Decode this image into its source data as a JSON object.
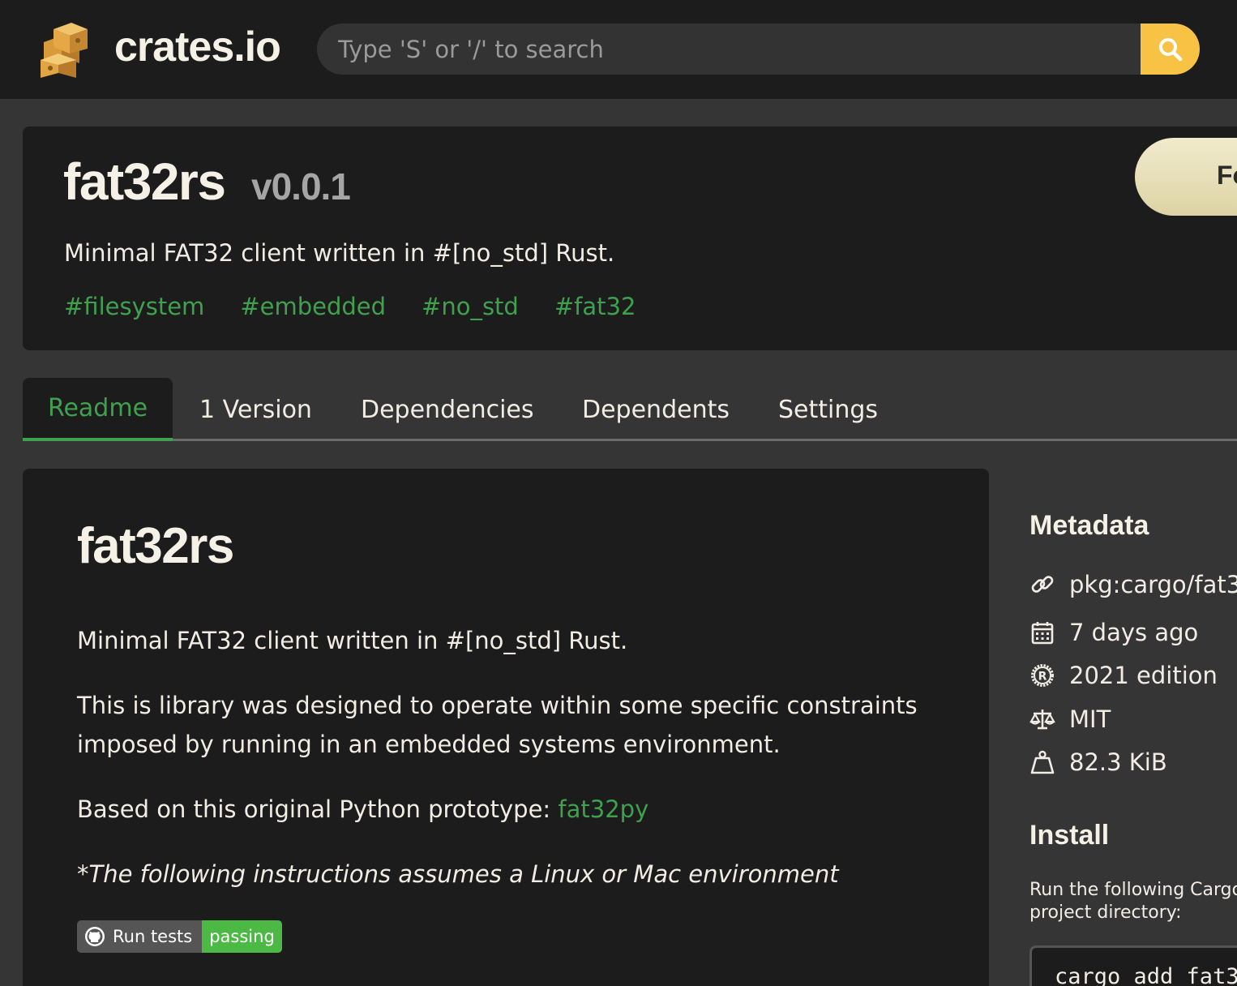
{
  "header": {
    "brand": "crates.io",
    "search_placeholder": "Type 'S' or '/' to search"
  },
  "crate": {
    "name": "fat32rs",
    "version": "v0.0.1",
    "description": "Minimal FAT32 client written in #[no_std] Rust.",
    "keywords": [
      "#filesystem",
      "#embedded",
      "#no_std",
      "#fat32"
    ],
    "follow_label": "Fo"
  },
  "tabs": [
    "Readme",
    "1 Version",
    "Dependencies",
    "Dependents",
    "Settings"
  ],
  "readme": {
    "title": "fat32rs",
    "p1": "Minimal FAT32 client written in #[no_std] Rust.",
    "p2": "This is library was designed to operate within some specific constraints imposed by running in an embedded systems environment.",
    "p3_prefix": "Based on this original Python prototype: ",
    "p3_link": "fat32py",
    "p4": "*The following instructions assumes a Linux or Mac environment",
    "badge_label": "Run tests",
    "badge_status": "passing"
  },
  "sidebar": {
    "metadata_heading": "Metadata",
    "metadata": [
      {
        "icon": "link-icon",
        "text": "pkg:cargo/fat3"
      },
      {
        "icon": "calendar-icon",
        "text": "7 days ago"
      },
      {
        "icon": "rust-icon",
        "text": "2021 edition"
      },
      {
        "icon": "scale-icon",
        "text": "MIT"
      },
      {
        "icon": "weight-icon",
        "text": "82.3 KiB"
      }
    ],
    "install_heading": "Install",
    "install_text": "Run the following Cargo project directory:",
    "install_command": "cargo add fat3"
  },
  "colors": {
    "accent_green": "#3fa14e",
    "search_button": "#f8c345",
    "background": "#353535",
    "card": "#1c1c1c"
  }
}
